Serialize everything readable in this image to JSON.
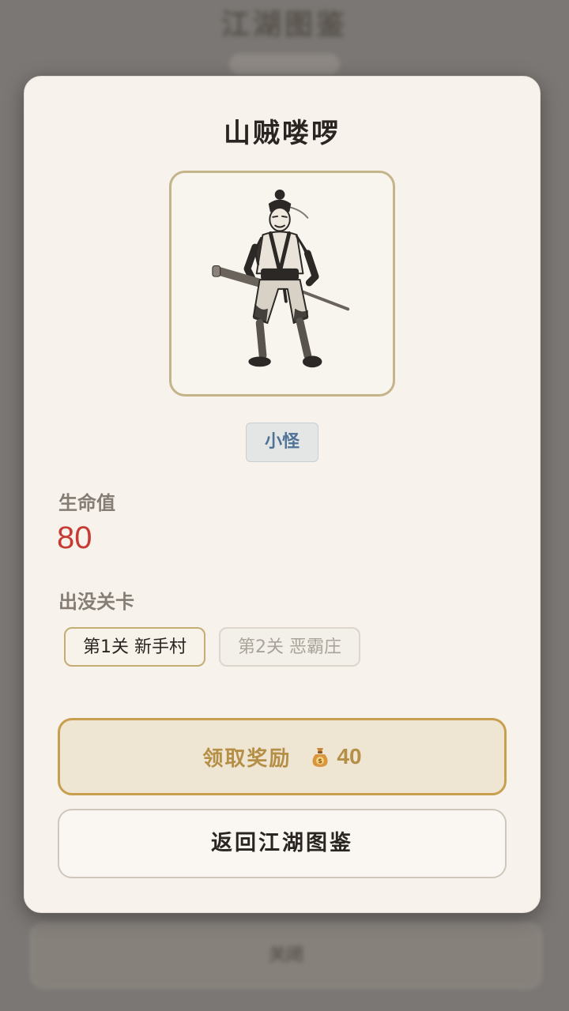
{
  "background": {
    "title": "江湖图鉴",
    "subtitle": "",
    "close_label": "关闭"
  },
  "modal": {
    "title": "山贼喽啰",
    "portrait_icon": "bandit-swordsman-ink-portrait",
    "type_badge": "小怪",
    "hp_label": "生命值",
    "hp_value": "80",
    "stages_label": "出没关卡",
    "stages": [
      {
        "label": "第1关 新手村",
        "unlocked": true
      },
      {
        "label": "第2关 恶霸庄",
        "unlocked": false
      }
    ],
    "reward_button": {
      "label": "领取奖励",
      "icon": "money-bag-icon",
      "amount": "40"
    },
    "back_button": "返回江湖图鉴"
  },
  "colors": {
    "modal_bg": "#f7f2ec",
    "accent_gold": "#c79f4e",
    "hp_red": "#c63b33",
    "badge_blue": "#4f7296",
    "overlay": "#7b7774"
  }
}
